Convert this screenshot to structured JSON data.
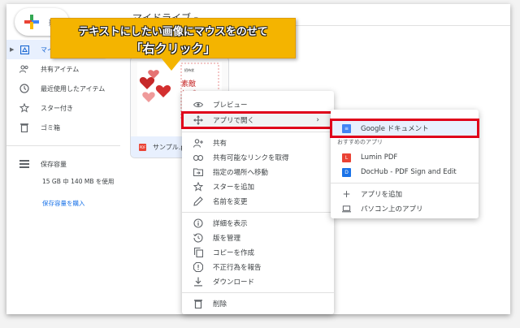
{
  "header": {
    "new_label": "新規",
    "breadcrumb": "マイドライブ",
    "breadcrumb_caret": "▾"
  },
  "sidebar": {
    "items": [
      {
        "label": "マイ",
        "icon": "drive-icon"
      },
      {
        "label": "共有アイテム",
        "icon": "shared-icon"
      },
      {
        "label": "最近使用したアイテム",
        "icon": "clock-icon"
      },
      {
        "label": "スター付き",
        "icon": "star-icon"
      },
      {
        "label": "ゴミ箱",
        "icon": "trash-icon"
      }
    ],
    "storage_label": "保存容量",
    "storage_usage": "15 GB 中 140 MB を使用",
    "storage_link": "保存容量を購入"
  },
  "file": {
    "name": "サンプル.pd",
    "type_badge": "PDF"
  },
  "callout": {
    "line1": "テキストにしたい画像にマウスをのせて",
    "line2": "「右クリック」"
  },
  "context_menu": {
    "items": [
      {
        "label": "プレビュー",
        "icon": "eye-icon"
      },
      {
        "label": "アプリで開く",
        "icon": "move-icon",
        "has_submenu": true,
        "highlighted": true
      },
      {
        "label": "共有",
        "icon": "person-add-icon"
      },
      {
        "label": "共有可能なリンクを取得",
        "icon": "link-icon"
      },
      {
        "label": "指定の場所へ移動",
        "icon": "folder-move-icon"
      },
      {
        "label": "スターを追加",
        "icon": "star-icon"
      },
      {
        "label": "名前を変更",
        "icon": "pencil-icon"
      },
      {
        "label": "詳細を表示",
        "icon": "info-icon"
      },
      {
        "label": "版を管理",
        "icon": "history-icon"
      },
      {
        "label": "コピーを作成",
        "icon": "copy-icon"
      },
      {
        "label": "不正行為を報告",
        "icon": "report-icon"
      },
      {
        "label": "ダウンロード",
        "icon": "download-icon"
      },
      {
        "label": "削除",
        "icon": "trash-icon"
      }
    ],
    "chevron": "›"
  },
  "submenu": {
    "items": [
      {
        "label": "Google ドキュメント",
        "icon": "docs-icon",
        "highlighted": true,
        "color": "#4285f4"
      },
      {
        "label": "Lumin PDF",
        "icon": "lumin-icon",
        "color": "#ea4335"
      },
      {
        "label": "DocHub - PDF Sign and Edit",
        "icon": "dochub-icon",
        "color": "#1a73e8"
      },
      {
        "label": "アプリを追加",
        "icon": "plus-icon"
      },
      {
        "label": "パソコン上のアプリ",
        "icon": "laptop-icon"
      }
    ],
    "section_label": "おすすめのアプリ"
  },
  "colors": {
    "accent": "#1a73e8",
    "highlight": "#e0001a",
    "callout": "#f4b400"
  }
}
